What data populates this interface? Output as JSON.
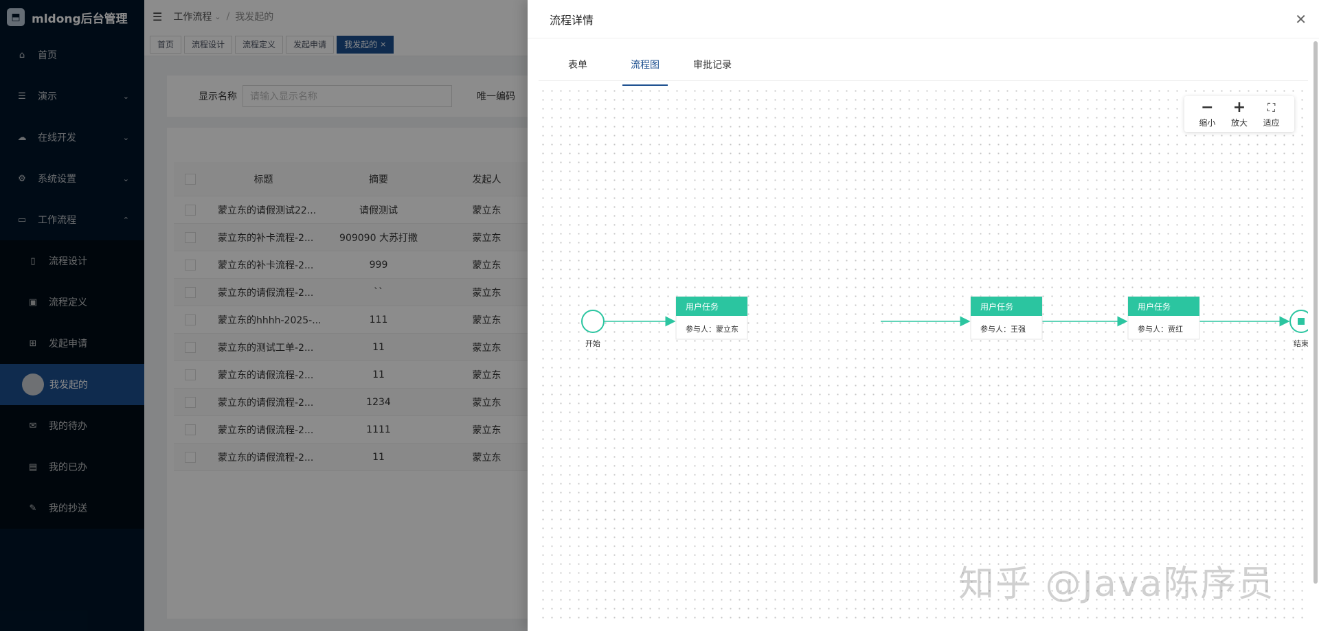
{
  "app": {
    "title": "mldong后台管理",
    "logo_glyph": "⬒"
  },
  "sidebar": {
    "items": [
      {
        "label": "首页",
        "icon": "⌂",
        "icon_name": "home-icon"
      },
      {
        "label": "演示",
        "icon": "☰",
        "icon_name": "list-icon",
        "chevron": "⌄"
      },
      {
        "label": "在线开发",
        "icon": "☁",
        "icon_name": "cloud-icon",
        "chevron": "⌄"
      },
      {
        "label": "系统设置",
        "icon": "⚙",
        "icon_name": "gear-icon",
        "chevron": "⌄"
      },
      {
        "label": "工作流程",
        "icon": "▭",
        "icon_name": "laptop-icon",
        "chevron": "⌃"
      }
    ],
    "sub_items": [
      {
        "label": "流程设计",
        "icon": "▯",
        "icon_name": "file-icon"
      },
      {
        "label": "流程定义",
        "icon": "▣",
        "icon_name": "image-icon"
      },
      {
        "label": "发起申请",
        "icon": "⊞",
        "icon_name": "grid-icon"
      },
      {
        "label": "我发起的",
        "icon": "",
        "icon_name": "avatar-icon",
        "active": true
      },
      {
        "label": "我的待办",
        "icon": "✉",
        "icon_name": "mail-icon"
      },
      {
        "label": "我的已办",
        "icon": "▤",
        "icon_name": "book-icon"
      },
      {
        "label": "我的抄送",
        "icon": "✎",
        "icon_name": "edit-icon"
      }
    ]
  },
  "header": {
    "fold_icon": "☰",
    "breadcrumb": [
      "工作流程",
      "我发起的"
    ],
    "breadcrumb_chevron": "⌄"
  },
  "tabs": [
    {
      "label": "首页"
    },
    {
      "label": "流程设计"
    },
    {
      "label": "流程定义"
    },
    {
      "label": "发起申请"
    },
    {
      "label": "我发起的",
      "active": true
    }
  ],
  "tab_close": "×",
  "search": {
    "field1_label": "显示名称",
    "field1_placeholder": "请输入显示名称",
    "field2_label": "唯一编码"
  },
  "table": {
    "headers": {
      "title": "标题",
      "summary": "摘要",
      "initiator": "发起人"
    },
    "rows": [
      {
        "title": "蒙立东的请假测试22...",
        "summary": "请假测试",
        "initiator": "蒙立东"
      },
      {
        "title": "蒙立东的补卡流程-2...",
        "summary": "909090 大苏打撒",
        "initiator": "蒙立东"
      },
      {
        "title": "蒙立东的补卡流程-2...",
        "summary": "999",
        "initiator": "蒙立东"
      },
      {
        "title": "蒙立东的请假流程-2...",
        "summary": "``",
        "initiator": "蒙立东"
      },
      {
        "title": "蒙立东的hhhh-2025-...",
        "summary": "111",
        "initiator": "蒙立东"
      },
      {
        "title": "蒙立东的测试工单-2...",
        "summary": "11",
        "initiator": "蒙立东"
      },
      {
        "title": "蒙立东的请假流程-2...",
        "summary": "11",
        "initiator": "蒙立东"
      },
      {
        "title": "蒙立东的请假流程-2...",
        "summary": "1234",
        "initiator": "蒙立东"
      },
      {
        "title": "蒙立东的请假流程-2...",
        "summary": "1111",
        "initiator": "蒙立东"
      },
      {
        "title": "蒙立东的请假流程-2...",
        "summary": "11",
        "initiator": "蒙立东"
      }
    ]
  },
  "drawer": {
    "title": "流程详情",
    "close": "✕",
    "tabs": [
      {
        "label": "表单"
      },
      {
        "label": "流程图",
        "active": true
      },
      {
        "label": "审批记录"
      }
    ],
    "zoom": [
      {
        "glyph": "−",
        "label": "缩小",
        "icon_name": "zoom-out-icon"
      },
      {
        "glyph": "+",
        "label": "放大",
        "icon_name": "zoom-in-icon"
      },
      {
        "glyph": "⛶",
        "label": "适应",
        "icon_name": "fit-icon"
      }
    ]
  },
  "flow": {
    "accent": "#2bc5a0",
    "start_label": "开始",
    "end_label": "结束",
    "tasks": [
      {
        "title": "用户任务",
        "participant": "参与人：蒙立东"
      },
      {
        "title": "用户任务",
        "participant": "参与人：王强"
      },
      {
        "title": "用户任务",
        "participant": "参与人：贾红"
      }
    ]
  },
  "watermark": "知乎 @Java陈序员"
}
